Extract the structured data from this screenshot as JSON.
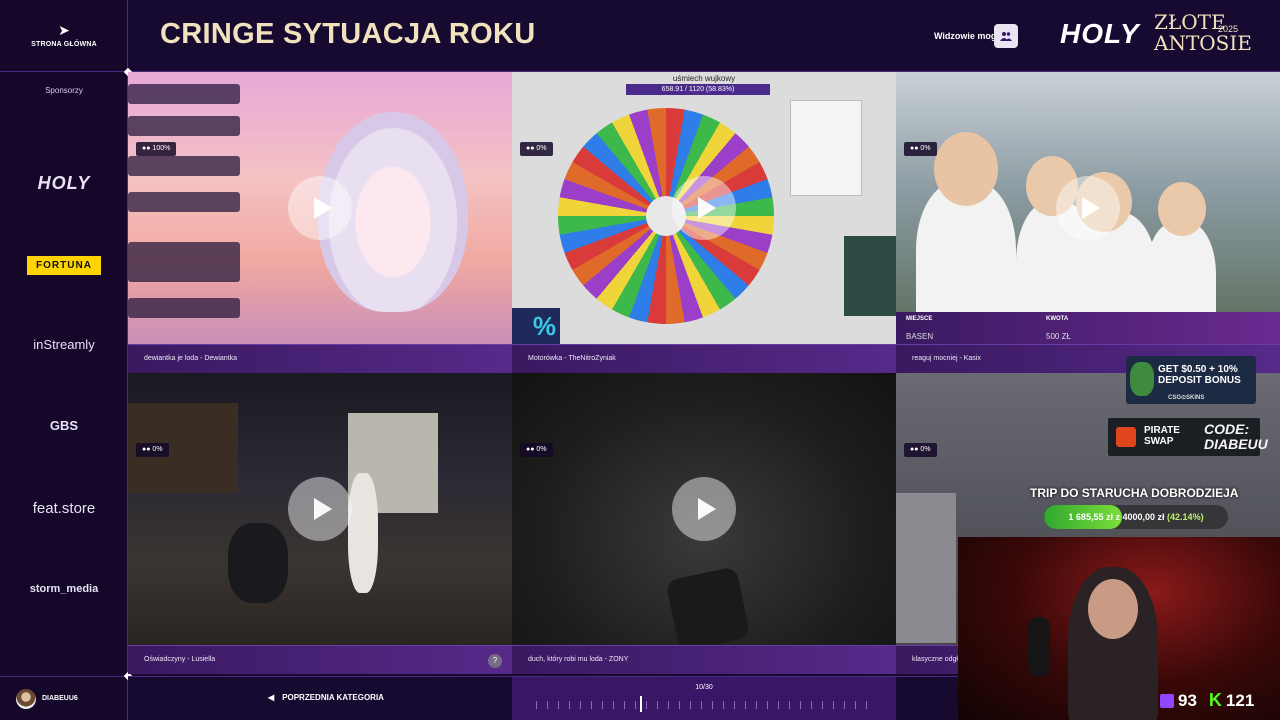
{
  "sidebar": {
    "home_label": "STRONA GŁÓWNA",
    "sponsors_title": "Sponsorzy",
    "sponsors": [
      "HOLY",
      "FORTUNA",
      "inStreamly",
      "GBS",
      "feat.store",
      "storm_media"
    ],
    "user_name": "DIABEUU6"
  },
  "header": {
    "title": "CRINGE SYTUACJA ROKU",
    "viewers_label": "Widzowie mogą",
    "brand_holy": "HOLY",
    "brand_zlote_line1": "ZŁOTE",
    "brand_zlote_line2": "ANTOSIE",
    "brand_year": "2025"
  },
  "tiles": [
    {
      "caption": "dewiantka je loda - Dewiantka",
      "badge": "100%"
    },
    {
      "caption": "Motorówka - TheNitroZyniak",
      "badge": "0%",
      "video_title": "uśmiech wujkowy",
      "video_bar": "658.91 / 1120 (58.83%)"
    },
    {
      "caption": "reaguj mocniej - Kasix",
      "badge": "0%",
      "overlay_labels": [
        "MIEJSCE",
        "KWOTA"
      ],
      "overlay_values": [
        "BASEN",
        "500 ZŁ"
      ]
    },
    {
      "caption": "Oświadczyny - Lusiella",
      "badge": "0%"
    },
    {
      "caption": "duch, który robi mu loda - ZONY",
      "badge": "0%"
    },
    {
      "caption": "klasyczne odgł",
      "badge": "0%"
    }
  ],
  "promos": {
    "csg_line1": "GET $0.50 + 10%",
    "csg_line2": "DEPOSIT BONUS",
    "csg_brand": "CSG⊙SKINS",
    "pirate": "PIRATE SWAP",
    "code": "CODE: DIABEUU"
  },
  "goal": {
    "title": "TRIP DO STARUCHA DOBRODZIEJA",
    "current": "1 685,55 zł",
    "target": "4000,00 zł",
    "percent_text": "(42.14%)",
    "progress": 0.4214
  },
  "stats": {
    "twitch": "93",
    "kick": "121"
  },
  "bottom": {
    "prev_label": "POPRZEDNIA KATEGORIA",
    "counter": "10/30"
  }
}
